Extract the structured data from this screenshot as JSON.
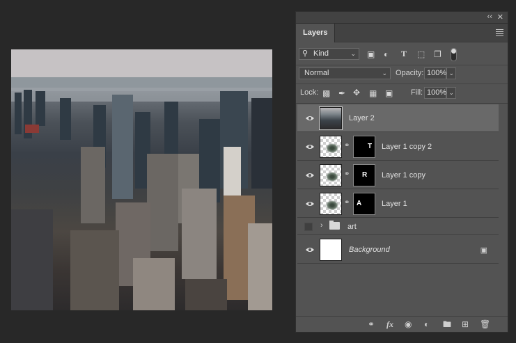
{
  "panel": {
    "tab_label": "Layers",
    "collapse_glyph": "‹‹",
    "close_glyph": "✕"
  },
  "filter": {
    "kind_label": "Kind",
    "icons": [
      "image-filter-icon",
      "adjustment-filter-icon",
      "type-filter-icon",
      "shape-filter-icon",
      "smart-object-filter-icon",
      "filter-toggle-icon"
    ]
  },
  "blend": {
    "mode": "Normal",
    "opacity_label": "Opacity:",
    "opacity_value": "100%"
  },
  "lock": {
    "label": "Lock:",
    "fill_label": "Fill:",
    "fill_value": "100%"
  },
  "layers": [
    {
      "name": "Layer 2",
      "visible": true,
      "selected": true,
      "mask_letter": ""
    },
    {
      "name": "Layer 1 copy 2",
      "visible": true,
      "selected": false,
      "mask_letter": "T"
    },
    {
      "name": "Layer 1 copy",
      "visible": true,
      "selected": false,
      "mask_letter": "R"
    },
    {
      "name": "Layer 1",
      "visible": true,
      "selected": false,
      "mask_letter": "A"
    },
    {
      "name": "art",
      "visible": false,
      "selected": false,
      "type": "group"
    },
    {
      "name": "Background",
      "visible": true,
      "selected": false,
      "locked": true
    }
  ],
  "footer": {
    "fx_label": "fx",
    "icons": [
      "link-layers-icon",
      "fx-icon",
      "add-mask-icon",
      "adjustment-layer-icon",
      "new-group-icon",
      "new-layer-icon",
      "trash-icon"
    ]
  },
  "colors": {
    "panel_bg": "#535353",
    "selected_row": "#696969",
    "canvas_bg": "#282828"
  }
}
